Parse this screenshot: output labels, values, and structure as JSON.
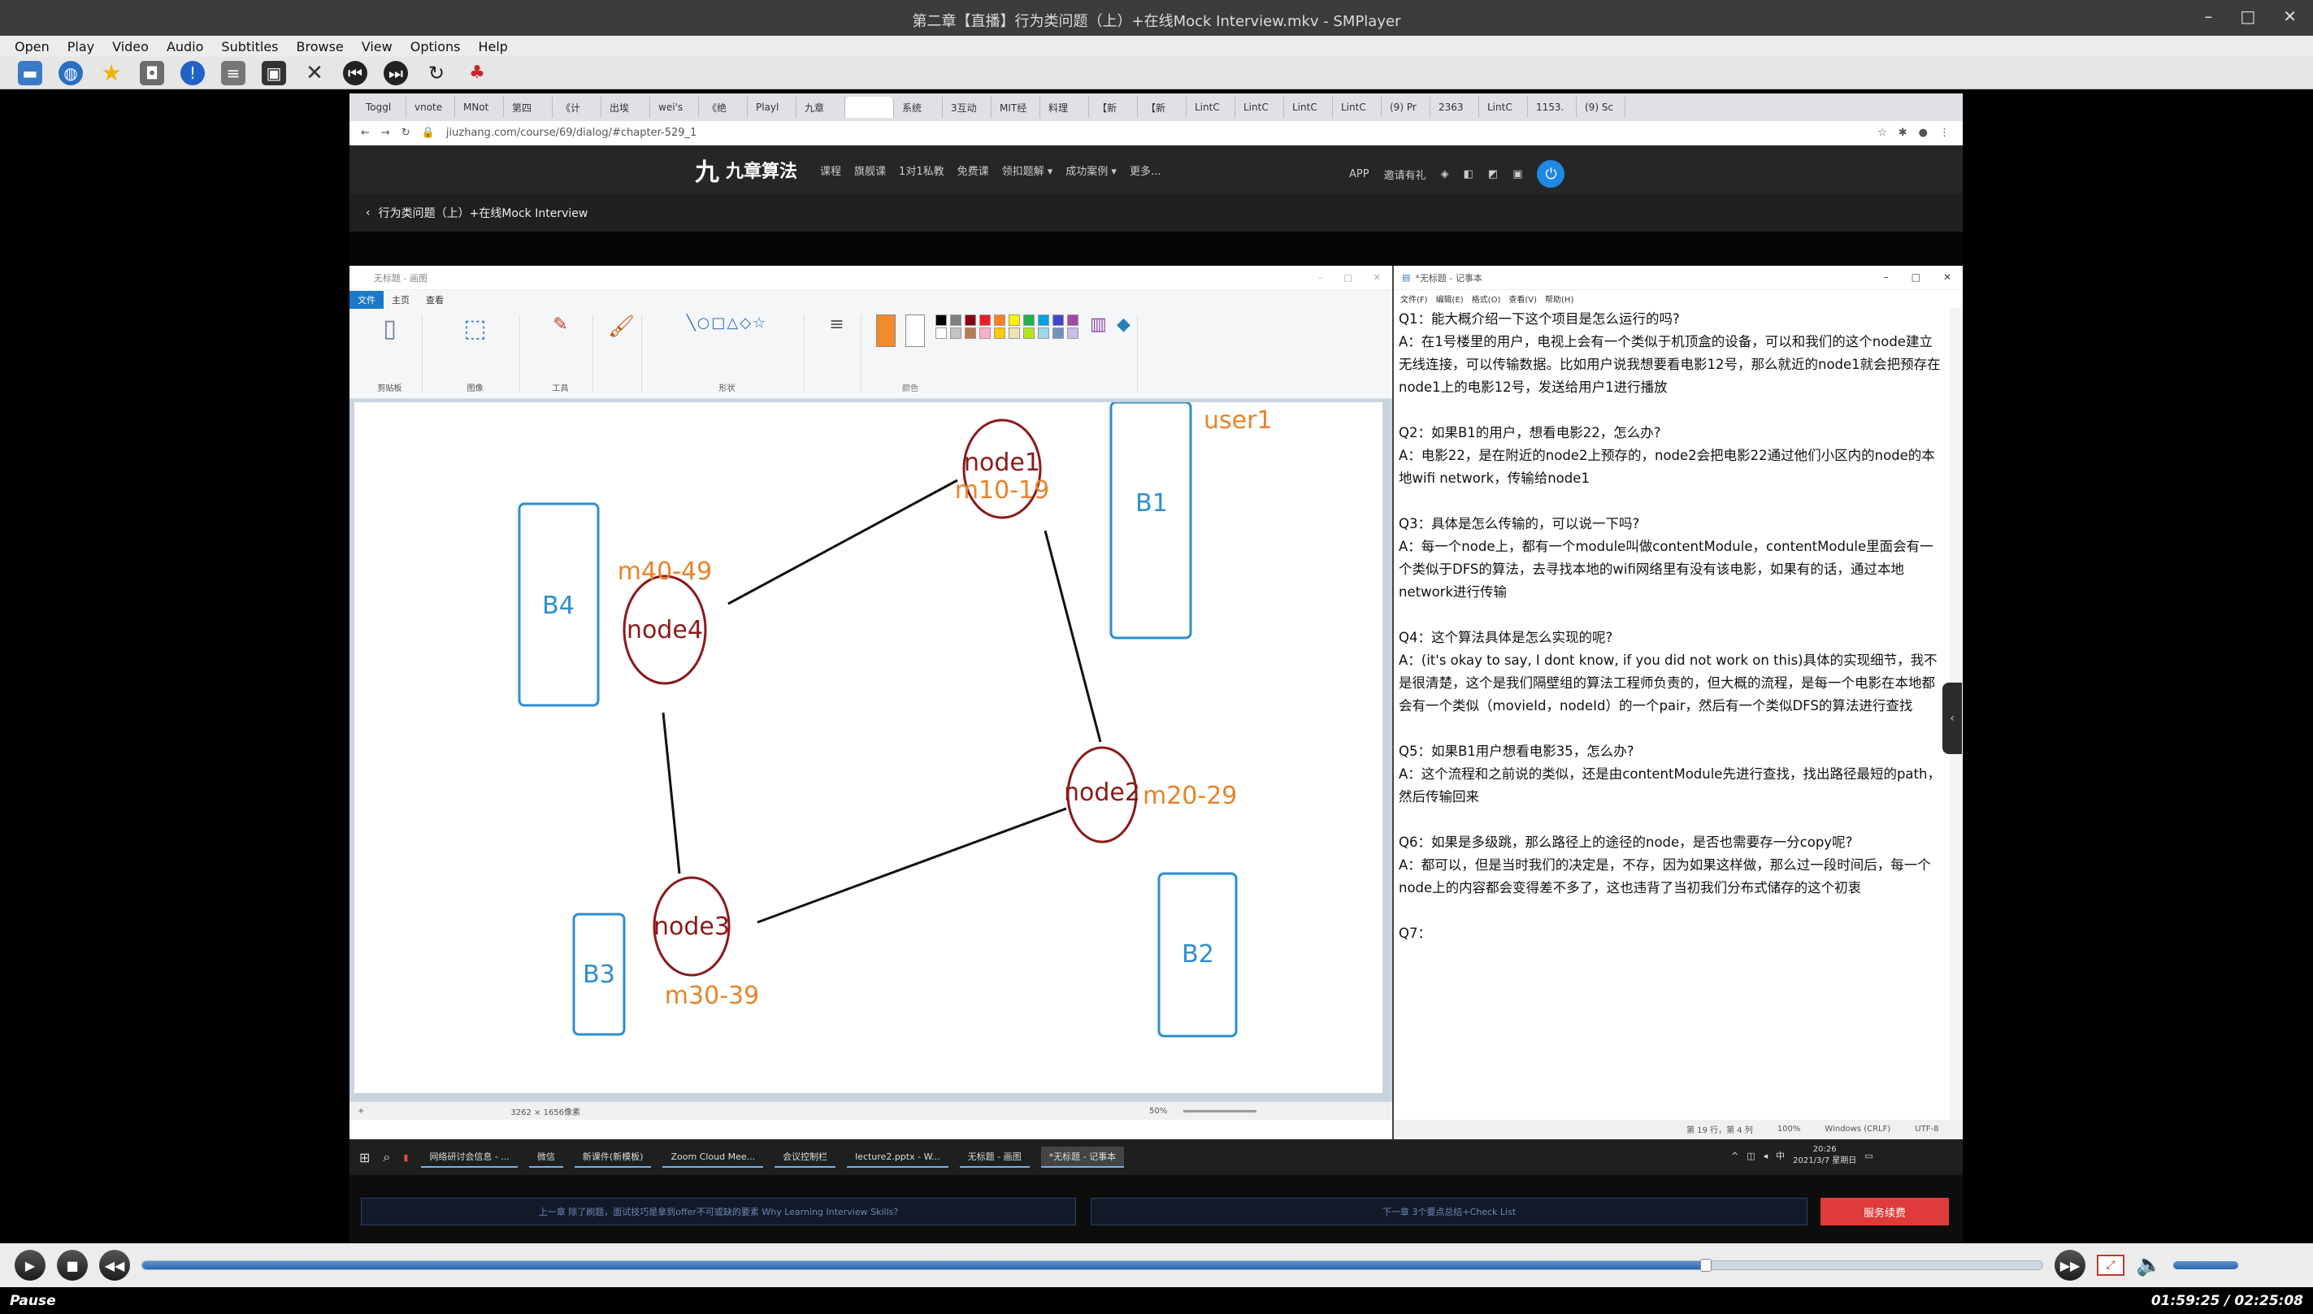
{
  "window": {
    "title": "第二章【直播】行为类问题（上）+在线Mock Interview.mkv - SMPlayer"
  },
  "menu": [
    "Open",
    "Play",
    "Video",
    "Audio",
    "Subtitles",
    "Browse",
    "View",
    "Options",
    "Help"
  ],
  "toolbar_icons": [
    "open-folder-icon",
    "globe-icon",
    "favorites-star-icon",
    "screenshot-icon",
    "info-icon",
    "playlist-icon",
    "preferences-icon",
    "tools-icon",
    "previous-icon",
    "next-icon",
    "loop-icon",
    "equalizer-icon"
  ],
  "browser": {
    "tabs": [
      "Toggl",
      "vnote",
      "MNot",
      "第四",
      "《计",
      "出埃",
      "wei's",
      "《绝",
      "Playl",
      "九章",
      "",
      "系统",
      "3互动",
      "MIT经",
      "料理",
      "【新",
      "【新",
      "LintC",
      "LintC",
      "LintC",
      "LintC",
      "(9) Pr",
      "2363",
      "LintC",
      "1153.",
      "(9) Sc"
    ],
    "url": "jiuzhang.com/course/69/dialog/#chapter-529_1",
    "site": {
      "logo": "九章算法",
      "nav": [
        "课程",
        "旗舰课",
        "1对1私教",
        "免费课",
        "领扣题解 ▾",
        "成功案例 ▾",
        "更多..."
      ],
      "header_right": [
        "APP",
        "邀请有礼"
      ],
      "breadcrumb": "行为类问题（上）+在线Mock Interview"
    }
  },
  "paint": {
    "title": "无标题 - 画图",
    "ribbon_tabs": [
      "文件",
      "主页",
      "查看"
    ],
    "groups": [
      "剪贴板",
      "图像",
      "工具",
      "形状",
      "颜色"
    ],
    "status": {
      "size": "3262 × 1656像素",
      "zoom": "50%"
    }
  },
  "diagram": {
    "nodes": [
      {
        "label": "node1",
        "range": "m10-19"
      },
      {
        "label": "node2",
        "range": "m20-29"
      },
      {
        "label": "node3",
        "range": "m30-39"
      },
      {
        "label": "node4",
        "range": "m40-49"
      }
    ],
    "boxes": [
      "B1",
      "B2",
      "B3",
      "B4"
    ],
    "user_label": "user1",
    "colors": {
      "node": "#8b1a1a",
      "range": "#e8832a",
      "box": "#2e8ecf",
      "edge": "#111111"
    }
  },
  "notepad": {
    "title": "*无标题 - 记事本",
    "menu": [
      "文件(F)",
      "编辑(E)",
      "格式(O)",
      "查看(V)",
      "帮助(H)"
    ],
    "qa": [
      {
        "q": "Q1：能大概介绍一下这个项目是怎么运行的吗?",
        "a": "A：在1号楼里的用户，电视上会有一个类似于机顶盒的设备，可以和我们的这个node建立无线连接，可以传输数据。比如用户说我想要看电影12号，那么就近的node1就会把预存在node1上的电影12号，发送给用户1进行播放"
      },
      {
        "q": "Q2：如果B1的用户，想看电影22，怎么办?",
        "a": "A：电影22，是在附近的node2上预存的，node2会把电影22通过他们小区内的node的本地wifi network，传输给node1"
      },
      {
        "q": "Q3：具体是怎么传输的，可以说一下吗?",
        "a": "A：每一个node上，都有一个module叫做contentModule，contentModule里面会有一个类似于DFS的算法，去寻找本地的wifi网络里有没有该电影，如果有的话，通过本地network进行传输"
      },
      {
        "q": "Q4：这个算法具体是怎么实现的呢?",
        "a": "A：(it's okay to say, I dont know, if you did not work on this)具体的实现细节，我不是很清楚，这个是我们隔壁组的算法工程师负责的，但大概的流程，是每一个电影在本地都会有一个类似（movieId，nodeId）的一个pair，然后有一个类似DFS的算法进行查找"
      },
      {
        "q": "Q5：如果B1用户想看电影35，怎么办?",
        "a": "A：这个流程和之前说的类似，还是由contentModule先进行查找，找出路径最短的path，然后传输回来"
      },
      {
        "q": "Q6：如果是多级跳，那么路径上的途径的node，是否也需要存一分copy呢?",
        "a": "A：都可以，但是当时我们的决定是，不存，因为如果这样做，那么过一段时间后，每一个node上的内容都会变得差不多了，这也违背了当初我们分布式储存的这个初衷"
      },
      {
        "q": "Q7：",
        "a": ""
      }
    ],
    "status": [
      "第 19 行，第 4 列",
      "100%",
      "Windows (CRLF)",
      "UTF-8"
    ]
  },
  "taskbar": {
    "apps": [
      "网络研讨会信息 - ...",
      "微信",
      "新课件(新模板)",
      "Zoom Cloud Mee...",
      "会议控制栏",
      "lecture2.pptx - W...",
      "无标题 - 画图",
      "*无标题 - 记事本"
    ],
    "time": "20:26",
    "date": "2021/3/7 星期日",
    "ime": "中"
  },
  "page_nav": {
    "prev": "上一章 除了刷题，面试技巧是拿到offer不可或缺的要素 Why Learning Interview Skills?",
    "next": "下一章 3个要点总结+Check List",
    "service": "服务续费"
  },
  "player": {
    "state": "Pause",
    "time": "01:59:25 / 02:25:08",
    "progress": 0.823
  }
}
